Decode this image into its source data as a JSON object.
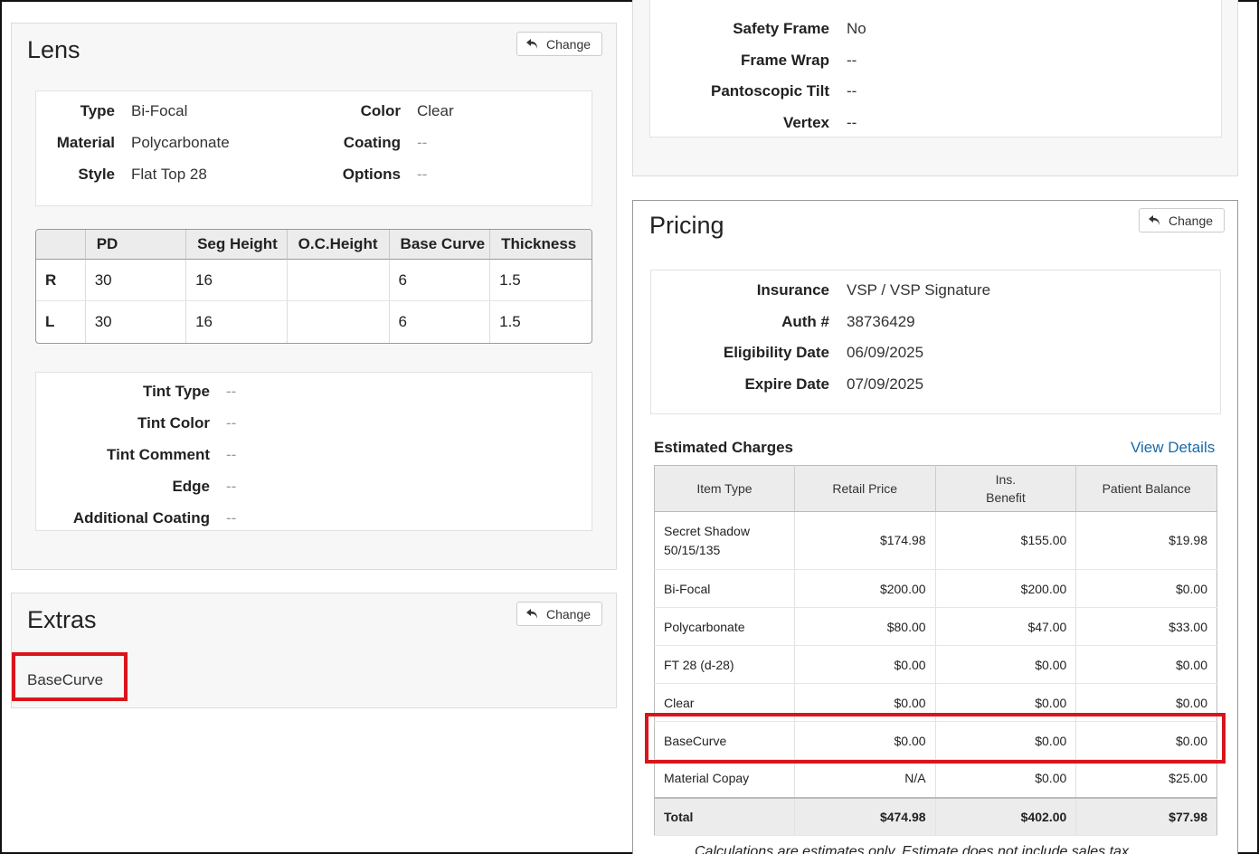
{
  "lens": {
    "title": "Lens",
    "change_label": "Change",
    "details": [
      {
        "label": "Type",
        "value": "Bi-Focal"
      },
      {
        "label": "Material",
        "value": "Polycarbonate"
      },
      {
        "label": "Style",
        "value": "Flat Top 28"
      },
      {
        "label": "Color",
        "value": "Clear"
      },
      {
        "label": "Coating",
        "value": "--"
      },
      {
        "label": "Options",
        "value": "--"
      }
    ],
    "measurements": {
      "headers": [
        "",
        "PD",
        "Seg Height",
        "O.C.Height",
        "Base Curve",
        "Thickness"
      ],
      "rows": [
        [
          "R",
          "30",
          "16",
          "",
          "6",
          "1.5"
        ],
        [
          "L",
          "30",
          "16",
          "",
          "6",
          "1.5"
        ]
      ]
    },
    "tint": [
      {
        "label": "Tint Type",
        "value": "--"
      },
      {
        "label": "Tint Color",
        "value": "--"
      },
      {
        "label": "Tint Comment",
        "value": "--"
      },
      {
        "label": "Edge",
        "value": "--"
      },
      {
        "label": "Additional Coating",
        "value": "--"
      }
    ]
  },
  "extras": {
    "title": "Extras",
    "change_label": "Change",
    "item": "BaseCurve"
  },
  "frame": {
    "fields": [
      {
        "label": "Safety Frame",
        "value": "No"
      },
      {
        "label": "Frame Wrap",
        "value": "--"
      },
      {
        "label": "Pantoscopic Tilt",
        "value": "--"
      },
      {
        "label": "Vertex",
        "value": "--"
      }
    ]
  },
  "pricing": {
    "title": "Pricing",
    "change_label": "Change",
    "insurance": [
      {
        "label": "Insurance",
        "value": "VSP / VSP Signature"
      },
      {
        "label": "Auth #",
        "value": "38736429"
      },
      {
        "label": "Eligibility Date",
        "value": "06/09/2025"
      },
      {
        "label": "Expire Date",
        "value": "07/09/2025"
      }
    ],
    "estimated_label": "Estimated Charges",
    "view_details": "View Details",
    "charges": {
      "headers": [
        "Item Type",
        "Retail Price",
        "Ins.\nBenefit",
        "Patient Balance"
      ],
      "header_ins_line1": "Ins.",
      "header_ins_line2": "Benefit",
      "rows": [
        {
          "item_line1": "Secret Shadow",
          "item_line2": "50/15/135",
          "retail": "$174.98",
          "benefit": "$155.00",
          "balance": "$19.98"
        },
        {
          "item": "Bi-Focal",
          "retail": "$200.00",
          "benefit": "$200.00",
          "balance": "$0.00"
        },
        {
          "item": "Polycarbonate",
          "retail": "$80.00",
          "benefit": "$47.00",
          "balance": "$33.00"
        },
        {
          "item": "FT 28 (d-28)",
          "retail": "$0.00",
          "benefit": "$0.00",
          "balance": "$0.00"
        },
        {
          "item": "Clear",
          "retail": "$0.00",
          "benefit": "$0.00",
          "balance": "$0.00"
        },
        {
          "item": "BaseCurve",
          "retail": "$0.00",
          "benefit": "$0.00",
          "balance": "$0.00"
        },
        {
          "item": "Material Copay",
          "retail": "N/A",
          "benefit": "$0.00",
          "balance": "$25.00"
        }
      ],
      "total": {
        "item": "Total",
        "retail": "$474.98",
        "benefit": "$402.00",
        "balance": "$77.98"
      }
    },
    "footnote": "Calculations are estimates only. Estimate does not include sales tax."
  },
  "colors": {
    "highlight": "#d9151b",
    "link": "#1a6aa5"
  },
  "icons": {
    "change": "undo-arrow-icon"
  }
}
